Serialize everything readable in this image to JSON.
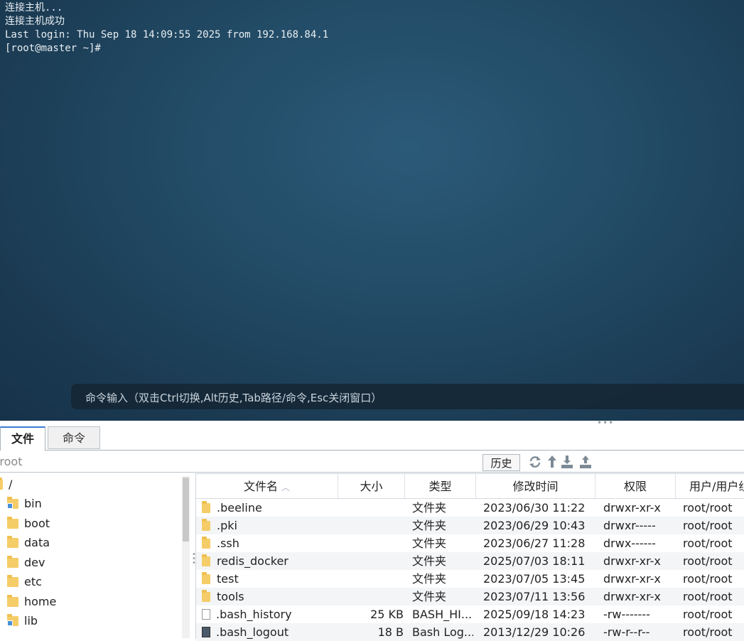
{
  "terminal": {
    "lines": [
      "连接主机...",
      "连接主机成功",
      "Last login: Thu Sep 18 14:09:55 2025 from 192.168.84.1",
      "[root@master ~]#"
    ],
    "command_hint": "命令输入（双击Ctrl切换,Alt历史,Tab路径/命令,Esc关闭窗口）"
  },
  "tabs": [
    {
      "label": "文件",
      "active": true
    },
    {
      "label": "命令",
      "active": false
    }
  ],
  "pathbar": {
    "path": "/root",
    "history_label": "历史",
    "icons": [
      "refresh-icon",
      "up-dir-icon",
      "download-icon",
      "upload-icon"
    ]
  },
  "tree": {
    "items": [
      {
        "label": "/",
        "link": false
      },
      {
        "label": "bin",
        "link": true
      },
      {
        "label": "boot",
        "link": false
      },
      {
        "label": "data",
        "link": false
      },
      {
        "label": "dev",
        "link": false
      },
      {
        "label": "etc",
        "link": false
      },
      {
        "label": "home",
        "link": false
      },
      {
        "label": "lib",
        "link": true
      }
    ]
  },
  "files": {
    "columns": [
      "文件名",
      "大小",
      "类型",
      "修改时间",
      "权限",
      "用户/用户组"
    ],
    "sort_indicator": "^",
    "rows": [
      {
        "name": ".beeline",
        "size": "",
        "type": "文件夹",
        "mtime": "2023/06/30 11:22",
        "perm": "drwxr-xr-x",
        "owner": "root/root",
        "kind": "folder"
      },
      {
        "name": ".pki",
        "size": "",
        "type": "文件夹",
        "mtime": "2023/06/29 10:43",
        "perm": "drwxr-----",
        "owner": "root/root",
        "kind": "folder"
      },
      {
        "name": ".ssh",
        "size": "",
        "type": "文件夹",
        "mtime": "2023/06/27 11:28",
        "perm": "drwx------",
        "owner": "root/root",
        "kind": "folder"
      },
      {
        "name": "redis_docker",
        "size": "",
        "type": "文件夹",
        "mtime": "2025/07/03 18:11",
        "perm": "drwxr-xr-x",
        "owner": "root/root",
        "kind": "folder"
      },
      {
        "name": "test",
        "size": "",
        "type": "文件夹",
        "mtime": "2023/07/05 13:45",
        "perm": "drwxr-xr-x",
        "owner": "root/root",
        "kind": "folder"
      },
      {
        "name": "tools",
        "size": "",
        "type": "文件夹",
        "mtime": "2023/07/11 13:56",
        "perm": "drwxr-xr-x",
        "owner": "root/root",
        "kind": "folder"
      },
      {
        "name": ".bash_history",
        "size": "25 KB",
        "type": "BASH_HI...",
        "mtime": "2025/09/18 14:23",
        "perm": "-rw-------",
        "owner": "root/root",
        "kind": "file"
      },
      {
        "name": ".bash_logout",
        "size": "18 B",
        "type": "Bash Log...",
        "mtime": "2013/12/29 10:26",
        "perm": "-rw-r--r--",
        "owner": "root/root",
        "kind": "script"
      }
    ]
  }
}
